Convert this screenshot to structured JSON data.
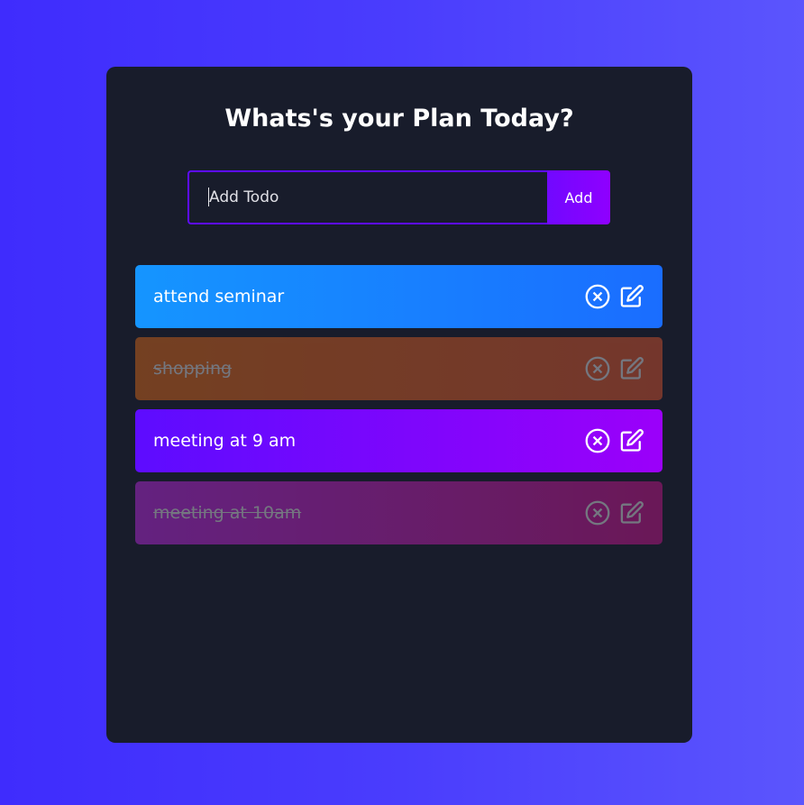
{
  "app": {
    "title": "Whats's your Plan Today?"
  },
  "form": {
    "placeholder": "Add Todo",
    "value": "",
    "add_label": "Add"
  },
  "todos": [
    {
      "text": "attend seminar",
      "complete": false,
      "gradient": [
        "#1595ff",
        "#1a6dff"
      ],
      "delete_icon": "circle-x-icon",
      "edit_icon": "edit-icon"
    },
    {
      "text": "shopping",
      "complete": true,
      "gradient": [
        "#ff7614",
        "#ff5f2f"
      ],
      "delete_icon": "circle-x-icon",
      "edit_icon": "edit-icon"
    },
    {
      "text": "meeting at 9 am",
      "complete": false,
      "gradient": [
        "#5d0cff",
        "#9b00fa"
      ],
      "delete_icon": "circle-x-icon",
      "edit_icon": "edit-icon"
    },
    {
      "text": "meeting at 10am",
      "complete": true,
      "gradient": [
        "#d62bff",
        "#e5139a"
      ],
      "delete_icon": "circle-x-icon",
      "edit_icon": "edit-icon"
    }
  ]
}
